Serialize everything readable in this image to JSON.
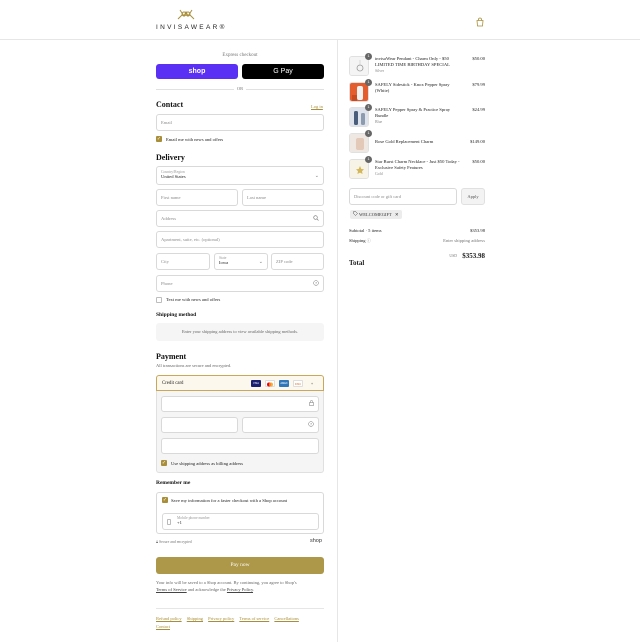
{
  "brand": {
    "name": "INVISAWEAR®",
    "accent": "#a98e3a",
    "pay_color": "#ad9748"
  },
  "express": {
    "label": "Express checkout",
    "shop_label": "shop",
    "gpay_label": "G Pay",
    "or_label": "OR"
  },
  "contact": {
    "title": "Contact",
    "login_label": "Log in",
    "email_placeholder": "Email",
    "email_news_label": "Email me with news and offers"
  },
  "delivery": {
    "title": "Delivery",
    "country_label": "Country/Region",
    "country_value": "United States",
    "first_name": "First name",
    "last_name": "Last name",
    "address": "Address",
    "apartment": "Apartment, suite, etc. (optional)",
    "city": "City",
    "state_label": "State",
    "state_value": "Iowa",
    "zip": "ZIP code",
    "phone": "Phone",
    "text_news_label": "Text me with news and offers"
  },
  "shipping": {
    "title": "Shipping method",
    "message": "Enter your shipping address to view available shipping methods."
  },
  "payment": {
    "title": "Payment",
    "subtitle": "All transactions are secure and encrypted.",
    "method_label": "Credit card",
    "card_icons": [
      "VISA",
      "MC",
      "AMEX",
      "DISC",
      "+"
    ],
    "billing_label": "Use shipping address as billing address"
  },
  "remember": {
    "title": "Remember me",
    "save_label": "Save my information for a faster checkout with a Shop account",
    "mobile_label": "Mobile phone number",
    "mobile_prefix": "+1",
    "secured_label": "Secure and encrypted",
    "shop_label": "shop"
  },
  "pay_now_label": "Pay now",
  "legal": {
    "text": "Your info will be saved to a Shop account. By continuing, you agree to Shop's",
    "terms": "Terms of Service",
    "and_text": " and acknowledge the ",
    "privacy": "Privacy Policy",
    "end": "."
  },
  "footer_links": [
    "Refund policy",
    "Shipping",
    "Privacy policy",
    "Terms of service",
    "Cancellations",
    "Contact"
  ],
  "order": {
    "items": [
      {
        "qty": "1",
        "name": "invisaWear Pendant - Charm Only - $50 LIMITED TIME BIRTHDAY SPECIAL",
        "variant": "Silver",
        "price": "$50.00",
        "thumb_color": "#f4f4f4"
      },
      {
        "qty": "1",
        "name": "SAFELY Sidestick - Knox Pepper Spray (White)",
        "variant": "",
        "price": "$79.99",
        "thumb_color": "#e35d2e"
      },
      {
        "qty": "1",
        "name": "SAFELY Pepper Spray & Practice Spray Bundle",
        "variant": "Blue",
        "price": "$24.99",
        "thumb_color": "#8d9bb0"
      },
      {
        "qty": "1",
        "name": "Rose Gold Replacement Charm",
        "variant": "",
        "price": "$149.00",
        "thumb_color": "#efe8e2"
      },
      {
        "qty": "1",
        "name": "Star Burst Charm Necklace - Just $50 Today - Exclusive Safety Features",
        "variant": "Gold",
        "price": "$50.00",
        "thumb_color": "#f7f3e6"
      }
    ],
    "discount_placeholder": "Discount code or gift card",
    "apply_label": "Apply",
    "applied_code": "WELCOMEGIFT",
    "subtotal_label": "Subtotal · 5 items",
    "subtotal_value": "$353.98",
    "shipping_label": "Shipping",
    "shipping_value": "Enter shipping address",
    "total_label": "Total",
    "currency": "USD",
    "total_value": "$353.98"
  }
}
